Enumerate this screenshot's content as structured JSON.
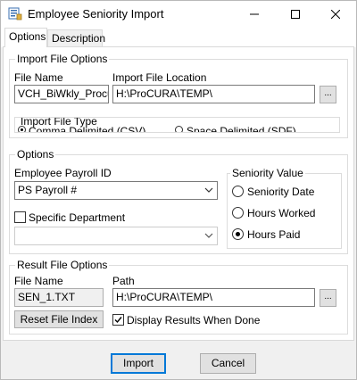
{
  "window": {
    "title": "Employee Seniority Import",
    "app_icon": "import-app-icon",
    "controls": {
      "minimize_icon": "minimize-icon",
      "maximize_icon": "maximize-icon",
      "close_icon": "close-icon"
    }
  },
  "tabs": [
    {
      "label": "Options",
      "active": true
    },
    {
      "label": "Description",
      "active": false
    }
  ],
  "import_file_options": {
    "group_label": "Import File Options",
    "file_name_label": "File Name",
    "file_name_value": "VCH_BiWkly_Procu",
    "location_label": "Import File Location",
    "location_value": "H:\\ProCURA\\TEMP\\",
    "browse_label": "...",
    "file_type": {
      "group_label": "Import File Type",
      "options": [
        {
          "label": "Comma Delimited (CSV)",
          "selected": true
        },
        {
          "label": "Space Delimited (SDF)",
          "selected": false
        }
      ]
    }
  },
  "options": {
    "group_label": "Options",
    "payroll_id_label": "Employee Payroll ID",
    "payroll_id_value": "PS Payroll #",
    "specific_dept_label": "Specific Department",
    "specific_dept_checked": false,
    "department_value": "",
    "seniority": {
      "group_label": "Seniority Value",
      "options": [
        {
          "label": "Seniority Date",
          "selected": false
        },
        {
          "label": "Hours Worked",
          "selected": false
        },
        {
          "label": "Hours Paid",
          "selected": true
        }
      ]
    }
  },
  "result_file_options": {
    "group_label": "Result File Options",
    "file_name_label": "File Name",
    "file_name_value": "SEN_1.TXT",
    "path_label": "Path",
    "path_value": "H:\\ProCURA\\TEMP\\",
    "browse_label": "...",
    "reset_label": "Reset File Index",
    "display_results_label": "Display Results When Done",
    "display_results_checked": true
  },
  "footer": {
    "import_label": "Import",
    "cancel_label": "Cancel"
  },
  "colors": {
    "default_button_border": "#0078d7",
    "window_bg": "#f0f0f0",
    "panel_bg": "#ffffff"
  }
}
